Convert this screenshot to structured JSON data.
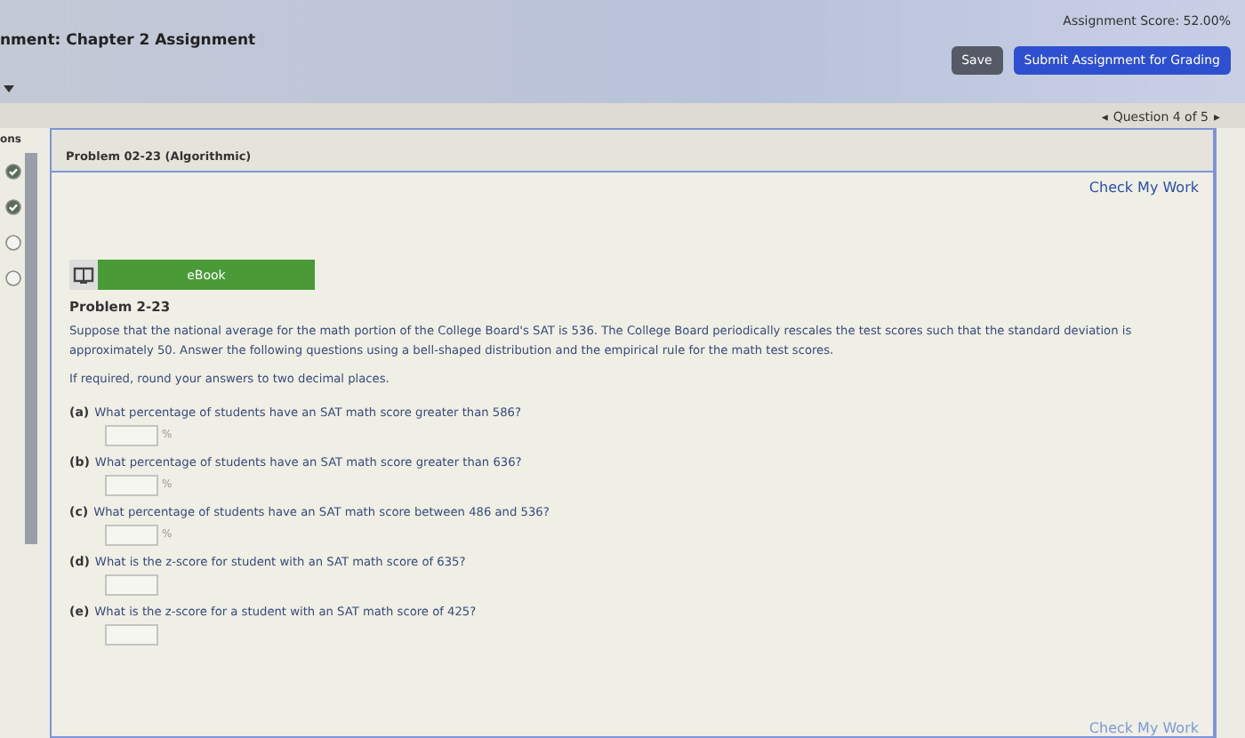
{
  "header": {
    "title": "nment: Chapter 2 Assignment",
    "score": "Assignment Score: 52.00%",
    "buttons": [
      {
        "label": "Save",
        "kind": "secondary"
      },
      {
        "label": "Submit Assignment for Grading",
        "kind": "primary"
      }
    ]
  },
  "question_nav": {
    "prev": "◂",
    "label": "Question 4 of 5",
    "next": "▸"
  },
  "sidebar": {
    "heading": "ons",
    "items": [
      {
        "done": true
      },
      {
        "done": true
      },
      {
        "done": false
      },
      {
        "done": false
      }
    ]
  },
  "problem": {
    "title": "Problem 02-23 (Algorithmic)",
    "check_link": "Check My Work",
    "ebook": "eBook",
    "heading": "Problem 2-23",
    "intro": "Suppose that the national average for the math portion of the College Board's SAT is 536. The College Board periodically rescales the test scores such that the standard deviation is approximately 50. Answer the following questions using a bell-shaped distribution and the empirical rule for the math test scores.",
    "note": "If required, round your answers to two decimal places.",
    "questions": [
      {
        "letter": "(a)",
        "text": "What percentage of students have an SAT math score greater than 586?",
        "unit": "%"
      },
      {
        "letter": "(b)",
        "text": "What percentage of students have an SAT math score greater than 636?",
        "unit": "%"
      },
      {
        "letter": "(c)",
        "text": "What percentage of students have an SAT math score between 486 and 536?",
        "unit": "%"
      },
      {
        "letter": "(d)",
        "text": "What is the z-score for student with an SAT math score of 635?"
      },
      {
        "letter": "(e)",
        "text": "What is the z-score for a student with an SAT math score of 425?"
      }
    ],
    "bottom_link": "Check My Work"
  }
}
